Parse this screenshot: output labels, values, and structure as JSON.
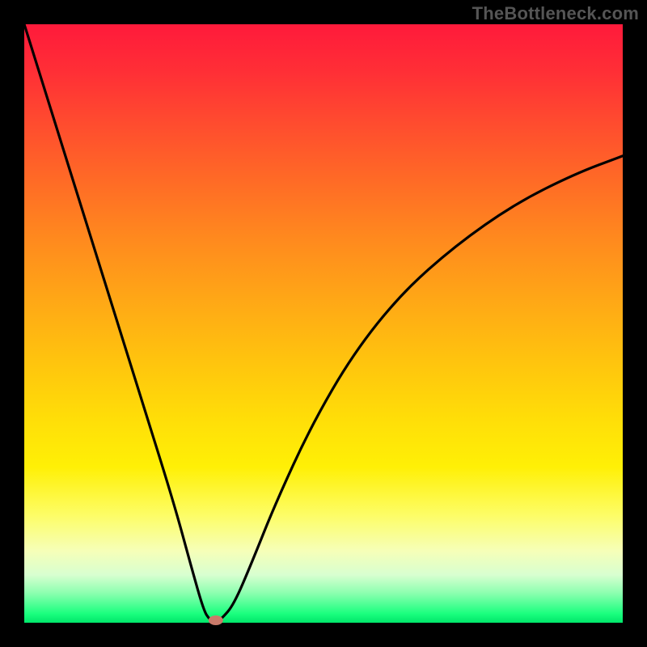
{
  "watermark": "TheBottleneck.com",
  "chart_data": {
    "type": "line",
    "title": "",
    "xlabel": "",
    "ylabel": "",
    "ylim": [
      0,
      100
    ],
    "xlim": [
      0,
      100
    ],
    "series": [
      {
        "name": "curve",
        "x": [
          0,
          5,
          10,
          15,
          20,
          25,
          28,
          30,
          31,
          32,
          33,
          35,
          38,
          42,
          48,
          55,
          63,
          72,
          82,
          92,
          100
        ],
        "y": [
          100,
          84,
          68,
          52,
          36,
          20,
          9,
          2,
          0.5,
          0,
          0.7,
          3,
          10,
          20,
          33,
          45,
          55,
          63,
          70,
          75,
          78
        ]
      }
    ],
    "marker": {
      "x": 32,
      "y": 0,
      "color": "#c97a6a"
    }
  }
}
